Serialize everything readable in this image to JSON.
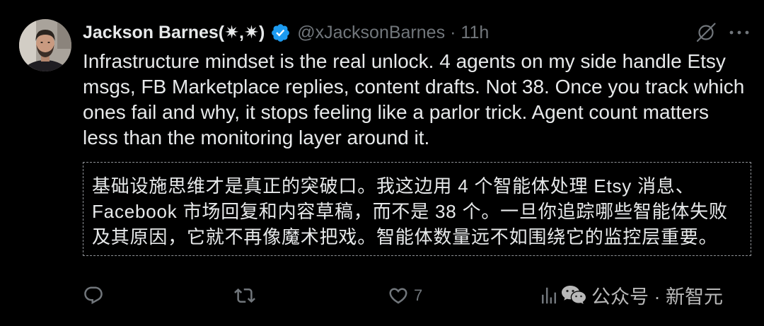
{
  "tweet": {
    "author": {
      "name": "Jackson Barnes(✷,✷)",
      "verified": true,
      "verified_icon": "verified-badge-icon",
      "avatar_icon": "avatar-photo",
      "handle": "@xJacksonBarnes",
      "separator": "·",
      "time": "11h"
    },
    "top_icons": {
      "grok": "grok-icon",
      "more": "more-icon"
    },
    "text_lines": [
      "Infrastructure mindset is the real unlock. 4 agents on my side handle Etsy",
      "msgs, FB Marketplace replies, content drafts. Not 38. Once you track which",
      "ones fail and why, it stops feeling like a parlor trick. Agent count matters",
      "less than the monitoring layer around it."
    ],
    "translation_lines": [
      "基础设施思维才是真正的突破口。我这边用 4 个智能体处理 Etsy 消息、",
      "Facebook 市场回复和内容草稿，而不是 38 个。一旦你追踪哪些智能体失败",
      "及其原因，它就不再像魔术把戏。智能体数量远不如围绕它的监控层重要。"
    ],
    "actions": {
      "reply_icon": "reply-icon",
      "retweet_icon": "retweet-icon",
      "like_icon": "heart-icon",
      "like_count": "7",
      "views_icon": "views-icon"
    }
  },
  "watermark": {
    "logo": "wechat-logo",
    "text": "公众号 · 新智元"
  },
  "colors": {
    "background": "#000000",
    "text": "#e7e9ea",
    "secondary": "#71767b",
    "verified": "#1d9bf0",
    "border": "#8e9196"
  }
}
